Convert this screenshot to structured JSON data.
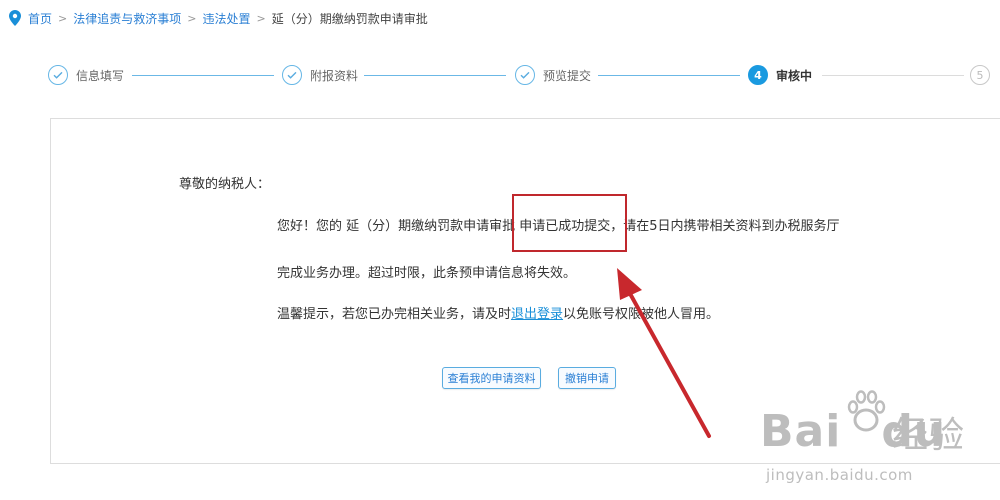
{
  "breadcrumb": {
    "items": [
      "首页",
      "法律追责与救济事项",
      "违法处置"
    ],
    "current": "延（分）期缴纳罚款申请审批",
    "separator": ">"
  },
  "steps": [
    {
      "label": "信息填写",
      "state": "done"
    },
    {
      "label": "附报资料",
      "state": "done"
    },
    {
      "label": "预览提交",
      "state": "done"
    },
    {
      "label": "审核中",
      "state": "active",
      "number": "4"
    },
    {
      "label": "",
      "state": "pending",
      "number": "5"
    }
  ],
  "message": {
    "salutation": "尊敬的纳税人：",
    "line1": "您好！您的 延（分）期缴纳罚款申请审批 申请已成功提交，请在5日内携带相关资料到办税服务厅",
    "line2": "完成业务办理。超过时限，此条预申请信息将失效。",
    "line3_before": "温馨提示，若您已办完相关业务，请及时",
    "line3_link": "退出登录",
    "line3_after": "以免账号权限被他人冒用。"
  },
  "buttons": {
    "view": "查看我的申请资料",
    "cancel": "撤销申请"
  },
  "watermark": {
    "brand": "Bai",
    "brand_end": "du",
    "cn": "经验",
    "url": "jingyan.baidu.com"
  },
  "colors": {
    "accent": "#1a9ae0",
    "link": "#2a7fd4",
    "annotation": "#c0282d"
  }
}
